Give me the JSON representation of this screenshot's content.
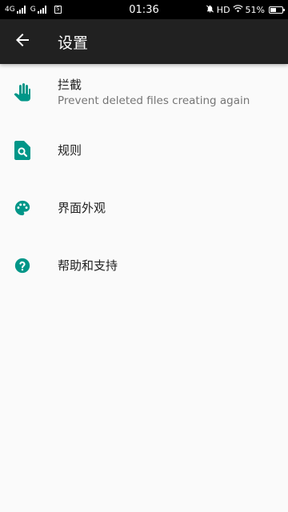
{
  "status_bar": {
    "network_1": "4G",
    "network_2": "G",
    "time": "01:36",
    "hd": "HD",
    "battery_text": "51%",
    "battery_level": 0.51
  },
  "app_bar": {
    "back_icon": "arrow-back-icon",
    "title": "设置"
  },
  "settings": [
    {
      "icon": "hand-block-icon",
      "title": "拦截",
      "subtitle": "Prevent deleted files creating again"
    },
    {
      "icon": "file-search-icon",
      "title": "规则"
    },
    {
      "icon": "palette-icon",
      "title": "界面外观"
    },
    {
      "icon": "help-icon",
      "title": "帮助和支持"
    }
  ],
  "colors": {
    "accent": "#009688",
    "app_bar": "#212121",
    "status_bar": "#000000",
    "background": "#fafafa"
  }
}
